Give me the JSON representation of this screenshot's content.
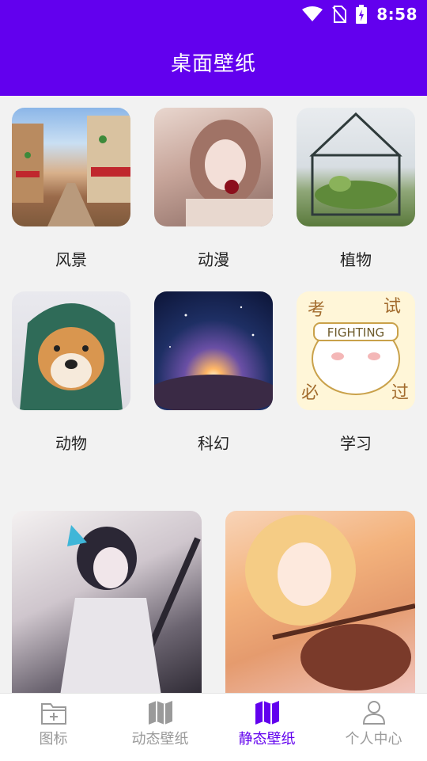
{
  "status": {
    "time": "8:58"
  },
  "header": {
    "title": "桌面壁纸"
  },
  "categories": [
    {
      "label": "风景"
    },
    {
      "label": "动漫"
    },
    {
      "label": "植物"
    },
    {
      "label": "动物"
    },
    {
      "label": "科幻"
    },
    {
      "label": "学习"
    }
  ],
  "wallpapers": {
    "study_thumb_text": {
      "top_left": "考",
      "top_right": "试",
      "banner": "FIGHTING",
      "bottom_left": "必",
      "bottom_right": "过"
    }
  },
  "nav": {
    "items": [
      {
        "label": "图标"
      },
      {
        "label": "动态壁纸"
      },
      {
        "label": "静态壁纸"
      },
      {
        "label": "个人中心"
      }
    ],
    "active_index": 2
  },
  "colors": {
    "primary": "#6200ee",
    "inactive": "#9a9a9a"
  }
}
